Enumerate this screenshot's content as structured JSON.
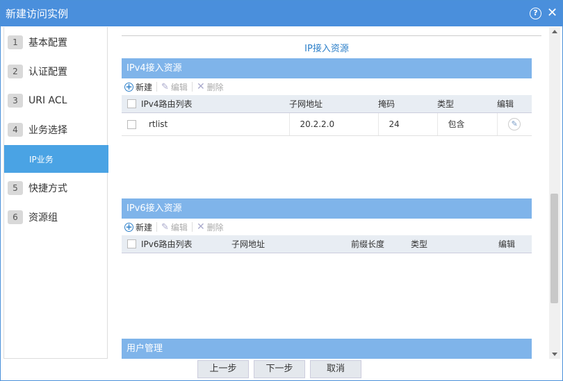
{
  "window": {
    "title": "新建访问实例"
  },
  "sidebar": {
    "items": [
      {
        "num": "1",
        "label": "基本配置"
      },
      {
        "num": "2",
        "label": "认证配置"
      },
      {
        "num": "3",
        "label": "URI ACL"
      },
      {
        "num": "4",
        "label": "业务选择"
      },
      {
        "num": "",
        "label": "IP业务"
      },
      {
        "num": "5",
        "label": "快捷方式"
      },
      {
        "num": "6",
        "label": "资源组"
      }
    ]
  },
  "main": {
    "heading": "IP接入资源",
    "ipv4": {
      "section_title": "IPv4接入资源",
      "toolbar": {
        "new": "新建",
        "edit": "编辑",
        "delete": "删除"
      },
      "columns": [
        "IPv4路由列表",
        "子网地址",
        "掩码",
        "类型",
        "编辑"
      ],
      "rows": [
        {
          "name": "rtlist",
          "subnet": "20.2.2.0",
          "mask": "24",
          "type": "包含"
        }
      ]
    },
    "ipv6": {
      "section_title": "IPv6接入资源",
      "toolbar": {
        "new": "新建",
        "edit": "编辑",
        "delete": "删除"
      },
      "columns": [
        "IPv6路由列表",
        "子网地址",
        "前缀长度",
        "类型",
        "编辑"
      ]
    },
    "user_mgmt": {
      "section_title": "用户管理"
    }
  },
  "footer": {
    "prev": "上一步",
    "next": "下一步",
    "cancel": "取消"
  }
}
